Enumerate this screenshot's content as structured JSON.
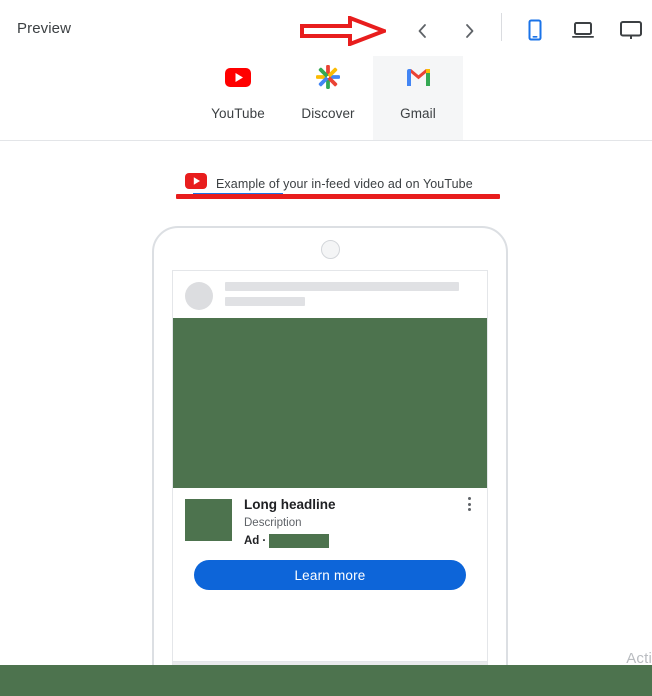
{
  "header": {
    "title": "Preview",
    "nav": {
      "prev_label": "‹",
      "next_label": "›"
    },
    "devices": [
      {
        "name": "mobile-device-icon",
        "label": "Mobile",
        "selected": true,
        "color": "#1a73e8"
      },
      {
        "name": "laptop-device-icon",
        "label": "Laptop",
        "selected": false,
        "color": "#3c4043"
      },
      {
        "name": "desktop-device-icon",
        "label": "Desktop",
        "selected": false,
        "color": "#3c4043"
      }
    ],
    "annotation": {
      "type": "red-arrow",
      "color": "#e81d1d",
      "points_to": "navigation-arrows"
    }
  },
  "tabs": {
    "items": [
      {
        "label": "YouTube",
        "icon": "youtube-icon",
        "selected": true
      },
      {
        "label": "Discover",
        "icon": "google-discover-icon",
        "selected": false
      },
      {
        "label": "Gmail",
        "icon": "gmail-icon",
        "selected": false,
        "hovered": true
      }
    ],
    "active_indicator_color": "#1a73e8"
  },
  "banner": {
    "icon": "youtube-icon",
    "text": "Example of your in-feed video ad on YouTube",
    "underline_color": "#e81d1d"
  },
  "preview": {
    "device": "mobile",
    "ad": {
      "headline": "Long headline",
      "description": "Description",
      "ad_label": "Ad",
      "ad_separator": "·",
      "advertiser_redacted": true,
      "cta_label": "Learn more",
      "cta_color": "#0d65d9",
      "media_color": "#4d734e",
      "menu_icon": "kebab-menu-icon"
    }
  },
  "overlay": {
    "watermark_text": "Acti",
    "bottom_band_color": "#4d734e"
  },
  "colors": {
    "accent_blue": "#1a73e8",
    "cta_blue": "#0d65d9",
    "annotation_red": "#e81d1d",
    "redaction_green": "#4d734e",
    "text_primary": "#3c4043"
  }
}
